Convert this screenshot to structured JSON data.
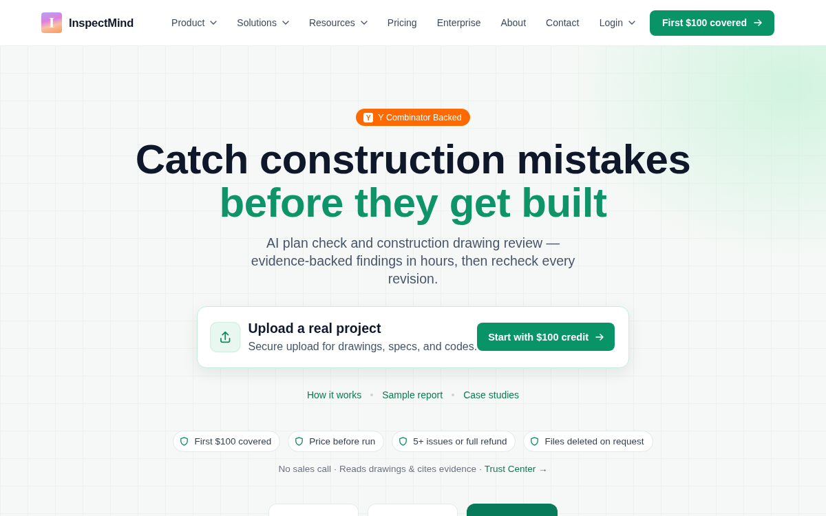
{
  "header": {
    "logo": {
      "mark": "I",
      "name": "InspectMind"
    },
    "nav": [
      {
        "label": "Product",
        "dropdown": true
      },
      {
        "label": "Solutions",
        "dropdown": true
      },
      {
        "label": "Resources",
        "dropdown": true
      },
      {
        "label": "Pricing",
        "dropdown": false
      },
      {
        "label": "Enterprise",
        "dropdown": false
      },
      {
        "label": "About",
        "dropdown": false
      },
      {
        "label": "Contact",
        "dropdown": false
      }
    ],
    "login": {
      "label": "Login",
      "dropdown": true
    },
    "cta": {
      "label": "First $100 covered"
    }
  },
  "hero": {
    "badge": {
      "icon_letter": "Y",
      "label": "Y Combinator Backed"
    },
    "title": "Catch construction mistakes",
    "title_accent": "before they get built",
    "subtitle": "AI plan check and construction drawing review — evidence-backed findings in hours, then recheck every revision."
  },
  "upload_card": {
    "title": "Upload a real project",
    "description": "Secure upload for drawings, specs, and codes.",
    "button": "Start with $100 credit"
  },
  "links": [
    "How it works",
    "Sample report",
    "Case studies"
  ],
  "trust_pills": [
    "First $100 covered",
    "Price before run",
    "5+ issues or full refund",
    "Files deleted on request"
  ],
  "footnote": {
    "text": "No sales call · Reads drawings & cites evidence ·",
    "link": "Trust Center →"
  },
  "bottom_tabs": [
    {
      "selected": false
    },
    {
      "selected": false
    },
    {
      "selected": true
    }
  ]
}
